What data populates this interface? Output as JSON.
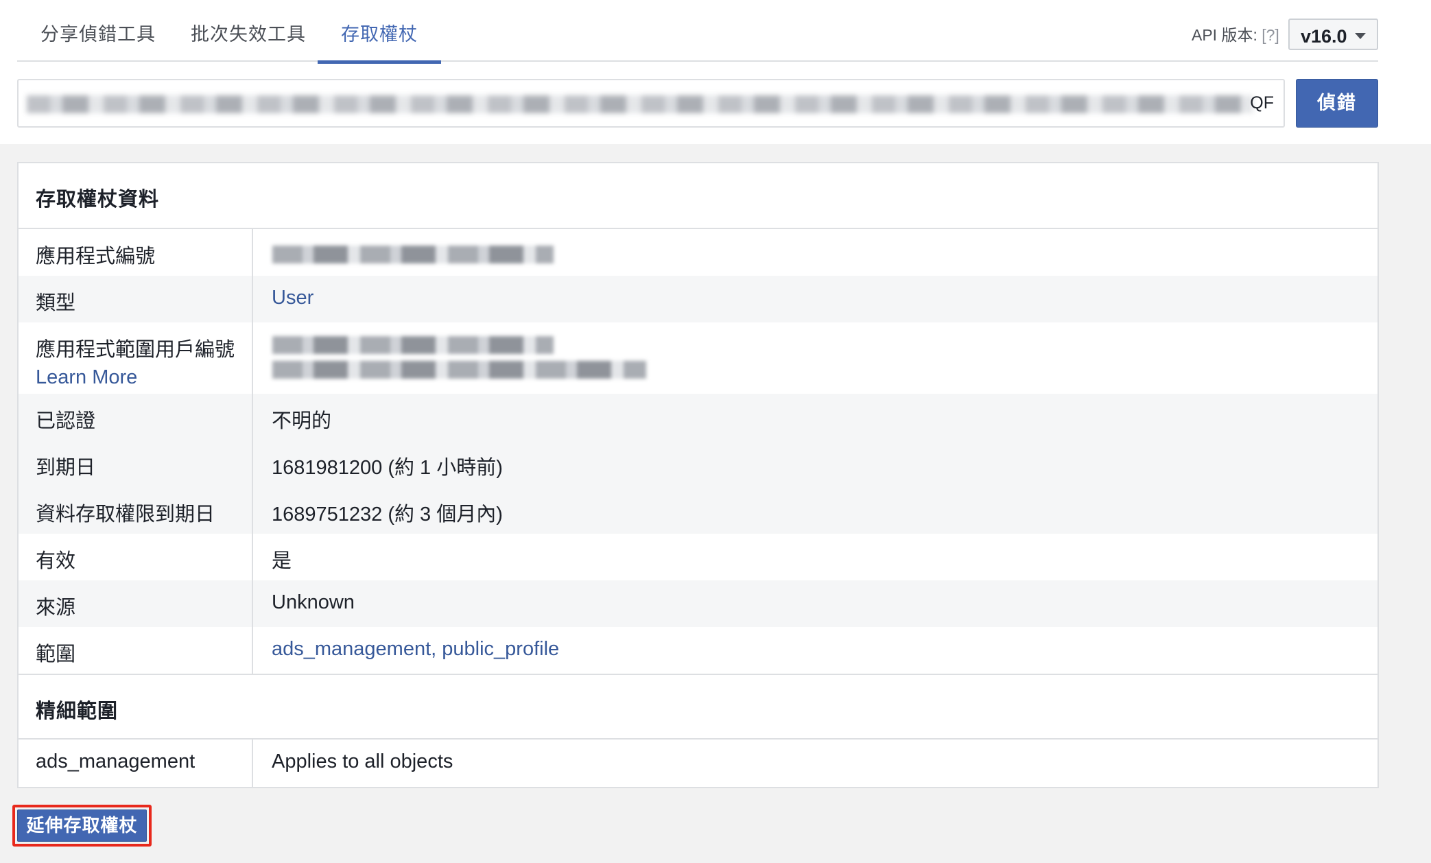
{
  "tabs": [
    {
      "label": "分享偵錯工具",
      "active": false
    },
    {
      "label": "批次失效工具",
      "active": false
    },
    {
      "label": "存取權杖",
      "active": true
    }
  ],
  "api": {
    "label": "API 版本:",
    "help": "[?]",
    "version": "v16.0"
  },
  "token": {
    "visible_tail": "QF"
  },
  "debug_button": "偵錯",
  "info": {
    "heading": "存取權杖資料",
    "rows": [
      {
        "key": "應用程式編號",
        "value": ""
      },
      {
        "key": "類型",
        "value": "User"
      },
      {
        "key": "應用程式範圍用戶編號",
        "key_link": "Learn More",
        "value": ""
      },
      {
        "key": "已認證",
        "value": "不明的"
      },
      {
        "key": "到期日",
        "value": "1681981200 (約 1 小時前)"
      },
      {
        "key": "資料存取權限到期日",
        "value": "1689751232 (約 3 個月內)"
      },
      {
        "key": "有效",
        "value": "是"
      },
      {
        "key": "來源",
        "value": "Unknown"
      },
      {
        "key": "範圍",
        "value": "ads_management, public_profile"
      }
    ]
  },
  "granular": {
    "heading": "精細範圍",
    "rows": [
      {
        "key": "ads_management",
        "value": "Applies to all objects"
      }
    ]
  },
  "extend_button": "延伸存取權杖",
  "colors": {
    "accent": "#4267b2",
    "link": "#365899",
    "highlight": "#e8291c"
  }
}
